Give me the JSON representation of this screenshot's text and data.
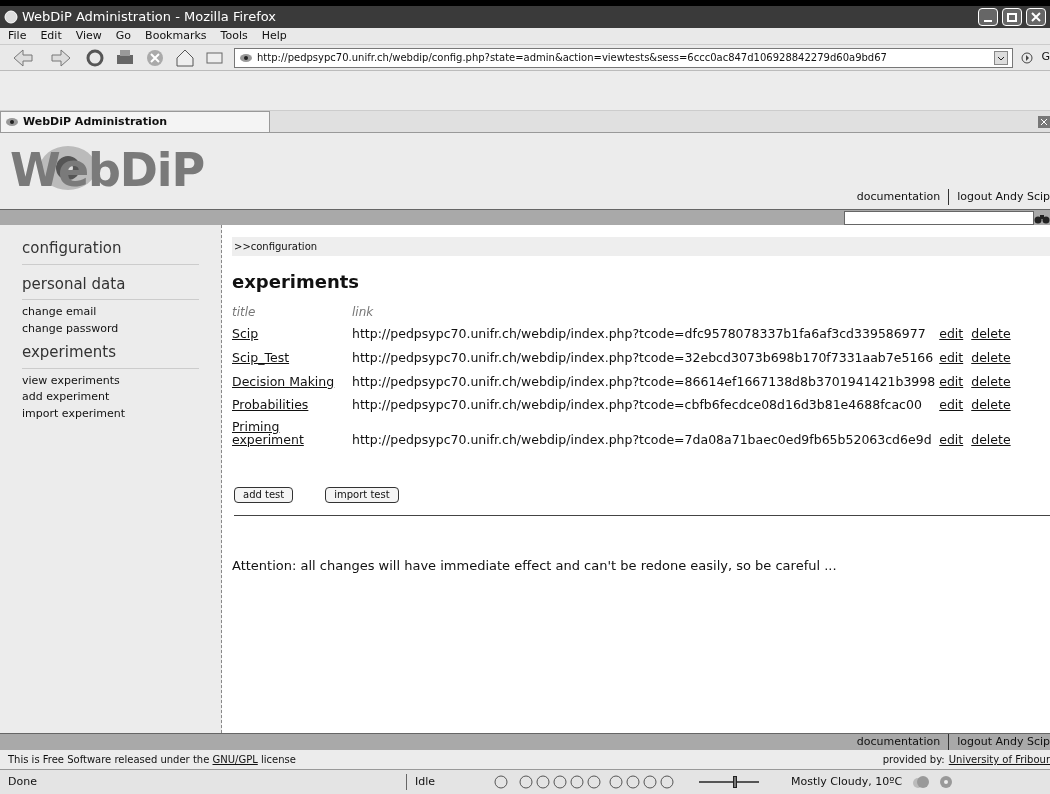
{
  "window": {
    "title": "WebDiP Administration - Mozilla Firefox"
  },
  "menu": [
    "File",
    "Edit",
    "View",
    "Go",
    "Bookmarks",
    "Tools",
    "Help"
  ],
  "address_bar": {
    "value": "http://pedpsypc70.unifr.ch/webdip/config.php?state=admin&action=viewtests&sess=6ccc0ac847d106928842279d60a9bd67",
    "go_label": "G"
  },
  "tab": {
    "title": "WebDiP Administration"
  },
  "header": {
    "logo": "WebDiP",
    "links": [
      "documentation",
      "logout Andy Scip"
    ]
  },
  "sidebar": {
    "sections": [
      {
        "title": "configuration"
      },
      {
        "title": "personal data",
        "items": [
          "change email",
          "change password"
        ]
      },
      {
        "title": "experiments",
        "items": [
          "view experiments",
          "add experiment",
          "import experiment"
        ]
      }
    ]
  },
  "breadcrumb": ">>configuration",
  "heading": "experiments",
  "table": {
    "columns": [
      "title",
      "link"
    ],
    "rows": [
      {
        "title": "Scip",
        "link": "http://pedpsypc70.unifr.ch/webdip/index.php?tcode=dfc9578078337b1fa6af3cd339586977",
        "edit": "edit",
        "delete": "delete"
      },
      {
        "title": "Scip_Test",
        "link": "http://pedpsypc70.unifr.ch/webdip/index.php?tcode=32ebcd3073b698b170f7331aab7e5166",
        "edit": "edit",
        "delete": "delete"
      },
      {
        "title": "Decision Making",
        "link": "http://pedpsypc70.unifr.ch/webdip/index.php?tcode=86614ef1667138d8b3701941421b3998",
        "edit": "edit",
        "delete": "delete"
      },
      {
        "title": "Probabilities",
        "link": "http://pedpsypc70.unifr.ch/webdip/index.php?tcode=cbfb6fecdce08d16d3b81e4688fcac00",
        "edit": "edit",
        "delete": "delete"
      },
      {
        "title": "Priming experiment",
        "link": "http://pedpsypc70.unifr.ch/webdip/index.php?tcode=7da08a71baec0ed9fb65b52063cd6e9d",
        "edit": "edit",
        "delete": "delete"
      }
    ]
  },
  "buttons": [
    "add test",
    "import test"
  ],
  "attention": "Attention: all changes will have immediate effect and can't be redone easily, so be careful ...",
  "footer": {
    "links": [
      "documentation",
      "logout Andy Scip"
    ],
    "license_before": "This is Free Software released under the",
    "license_link": "GNU/GPL",
    "license_after": "license",
    "provided_label": "provided by:",
    "provided_link": "University of Fribour"
  },
  "status_bar": {
    "status": "Done",
    "player": "Idle",
    "volume": {
      "level": 0.6
    },
    "weather": "Mostly Cloudy, 10ºC"
  }
}
